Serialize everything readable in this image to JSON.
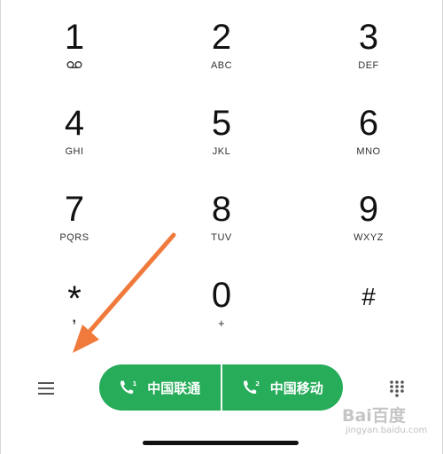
{
  "keypad": {
    "keys": [
      {
        "digit": "1",
        "letters": "",
        "icon": "voicemail-icon"
      },
      {
        "digit": "2",
        "letters": "ABC"
      },
      {
        "digit": "3",
        "letters": "DEF"
      },
      {
        "digit": "4",
        "letters": "GHI"
      },
      {
        "digit": "5",
        "letters": "JKL"
      },
      {
        "digit": "6",
        "letters": "MNO"
      },
      {
        "digit": "7",
        "letters": "PQRS"
      },
      {
        "digit": "8",
        "letters": "TUV"
      },
      {
        "digit": "9",
        "letters": "WXYZ"
      },
      {
        "digit": "*",
        "letters": ","
      },
      {
        "digit": "0",
        "letters": "+"
      },
      {
        "digit": "#",
        "letters": ""
      }
    ]
  },
  "bottom_bar": {
    "menu_icon": "menu-icon",
    "dialpad_icon": "dialpad-toggle-icon",
    "call_buttons": [
      {
        "label": "中国联通",
        "sim": "1",
        "icon": "phone-sim1-icon"
      },
      {
        "label": "中国移动",
        "sim": "2",
        "icon": "phone-sim2-icon"
      }
    ]
  },
  "colors": {
    "call_green": "#27ac5a",
    "arrow_orange": "#f07a3c"
  },
  "watermark": {
    "main": "Bai百度",
    "sub": "jingyan.baidu.com"
  }
}
